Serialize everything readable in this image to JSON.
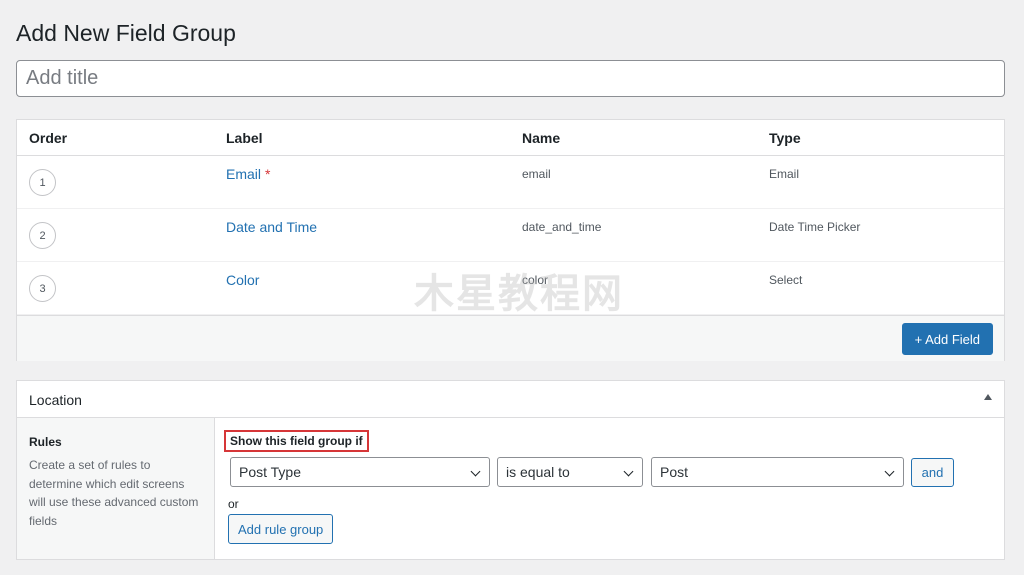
{
  "page": {
    "title": "Add New Field Group"
  },
  "title_input": {
    "placeholder": "Add title",
    "value": ""
  },
  "fields_table": {
    "headers": {
      "order": "Order",
      "label": "Label",
      "name": "Name",
      "type": "Type"
    },
    "rows": [
      {
        "order": "1",
        "label": "Email",
        "required": "*",
        "name": "email",
        "type": "Email"
      },
      {
        "order": "2",
        "label": "Date and Time",
        "required": "",
        "name": "date_and_time",
        "type": "Date Time Picker"
      },
      {
        "order": "3",
        "label": "Color",
        "required": "",
        "name": "color",
        "type": "Select"
      }
    ],
    "add_field_label": "+ Add Field"
  },
  "watermark": "木星教程网",
  "location": {
    "title": "Location",
    "toggle_icon": "triangle-up-icon",
    "rules_title": "Rules",
    "rules_desc": "Create a set of rules to determine which edit screens will use these advanced custom fields",
    "show_if_label": "Show this field group if",
    "param": "Post Type",
    "operator": "is equal to",
    "value": "Post",
    "and_label": "and",
    "or_label": "or",
    "add_rule_group_label": "Add rule group"
  },
  "colors": {
    "accent": "#2271b1",
    "highlight_border": "#d63638",
    "required": "#d63638"
  }
}
